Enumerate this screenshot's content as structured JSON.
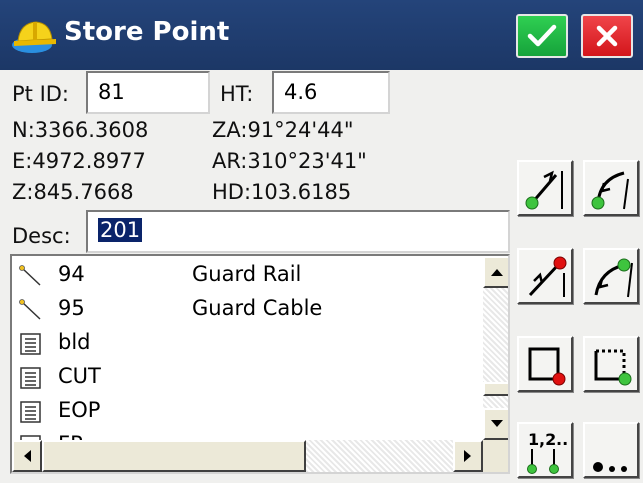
{
  "window": {
    "title": "Store Point"
  },
  "form": {
    "pt_id_label": "Pt ID:",
    "pt_id_value": "81",
    "ht_label": "HT:",
    "ht_value": "4.6",
    "n_text": "N:3366.3608",
    "e_text": "E:4972.8977",
    "z_text": "Z:845.7668",
    "za_text": "ZA:91°24'44\"",
    "ar_text": "AR:310°23'41\"",
    "hd_text": "HD:103.6185",
    "desc_label": "Desc:",
    "desc_value": "201"
  },
  "list": {
    "items": [
      {
        "icon": "line-icon",
        "name": "94",
        "desc": "Guard Rail"
      },
      {
        "icon": "line-icon",
        "name": "95",
        "desc": "Guard Cable"
      },
      {
        "icon": "document-icon",
        "name": "bld",
        "desc": ""
      },
      {
        "icon": "document-icon",
        "name": "CUT",
        "desc": ""
      },
      {
        "icon": "document-icon",
        "name": "EOP",
        "desc": ""
      },
      {
        "icon": "document-icon",
        "name": "FP",
        "desc": ""
      }
    ]
  },
  "tools": [
    "line-start-icon",
    "arc-start-icon",
    "line-end-icon",
    "arc-end-icon",
    "close-rectangle-icon",
    "close-rectangle-dashed-icon",
    "numbered-points-icon",
    "more-points-icon"
  ],
  "colors": {
    "titlebar": "#1f3c70",
    "ok": "#16a33b",
    "cancel": "#d3151b",
    "selection": "#0a246a",
    "node_green": "#3ec43e",
    "node_red": "#e01010"
  }
}
